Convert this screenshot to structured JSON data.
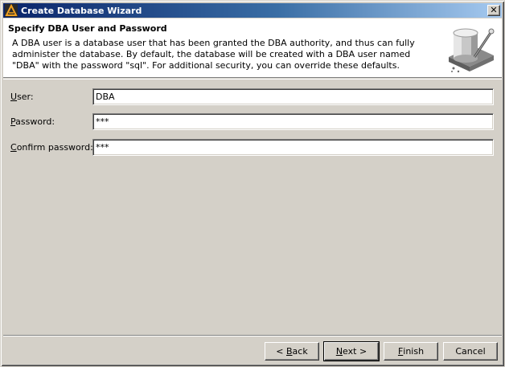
{
  "window": {
    "title": "Create Database Wizard",
    "close_label": "✕"
  },
  "header": {
    "title": "Specify DBA User and Password",
    "description": "A DBA user is a database user that has been granted the DBA authority, and thus can fully administer the database. By default, the database will be created with a DBA user named \"DBA\" with the password \"sql\". For additional security, you can override these defaults.",
    "image_icon": "database-wizard-icon"
  },
  "form": {
    "user": {
      "label_mnemonic": "U",
      "label_rest": "ser:",
      "value": "DBA"
    },
    "password": {
      "label_mnemonic": "P",
      "label_rest": "assword:",
      "value": "***"
    },
    "confirm_password": {
      "label_mnemonic": "C",
      "label_rest": "onfirm password:",
      "value": "***"
    }
  },
  "buttons": {
    "back_lt": "< ",
    "back_mnemonic": "B",
    "back_rest": "ack",
    "next_mnemonic": "N",
    "next_rest": "ext >",
    "finish_mnemonic": "F",
    "finish_rest": "inish",
    "cancel": "Cancel"
  },
  "colors": {
    "titlebar_start": "#0a246a",
    "titlebar_end": "#a6caf0",
    "face": "#d4d0c8"
  }
}
